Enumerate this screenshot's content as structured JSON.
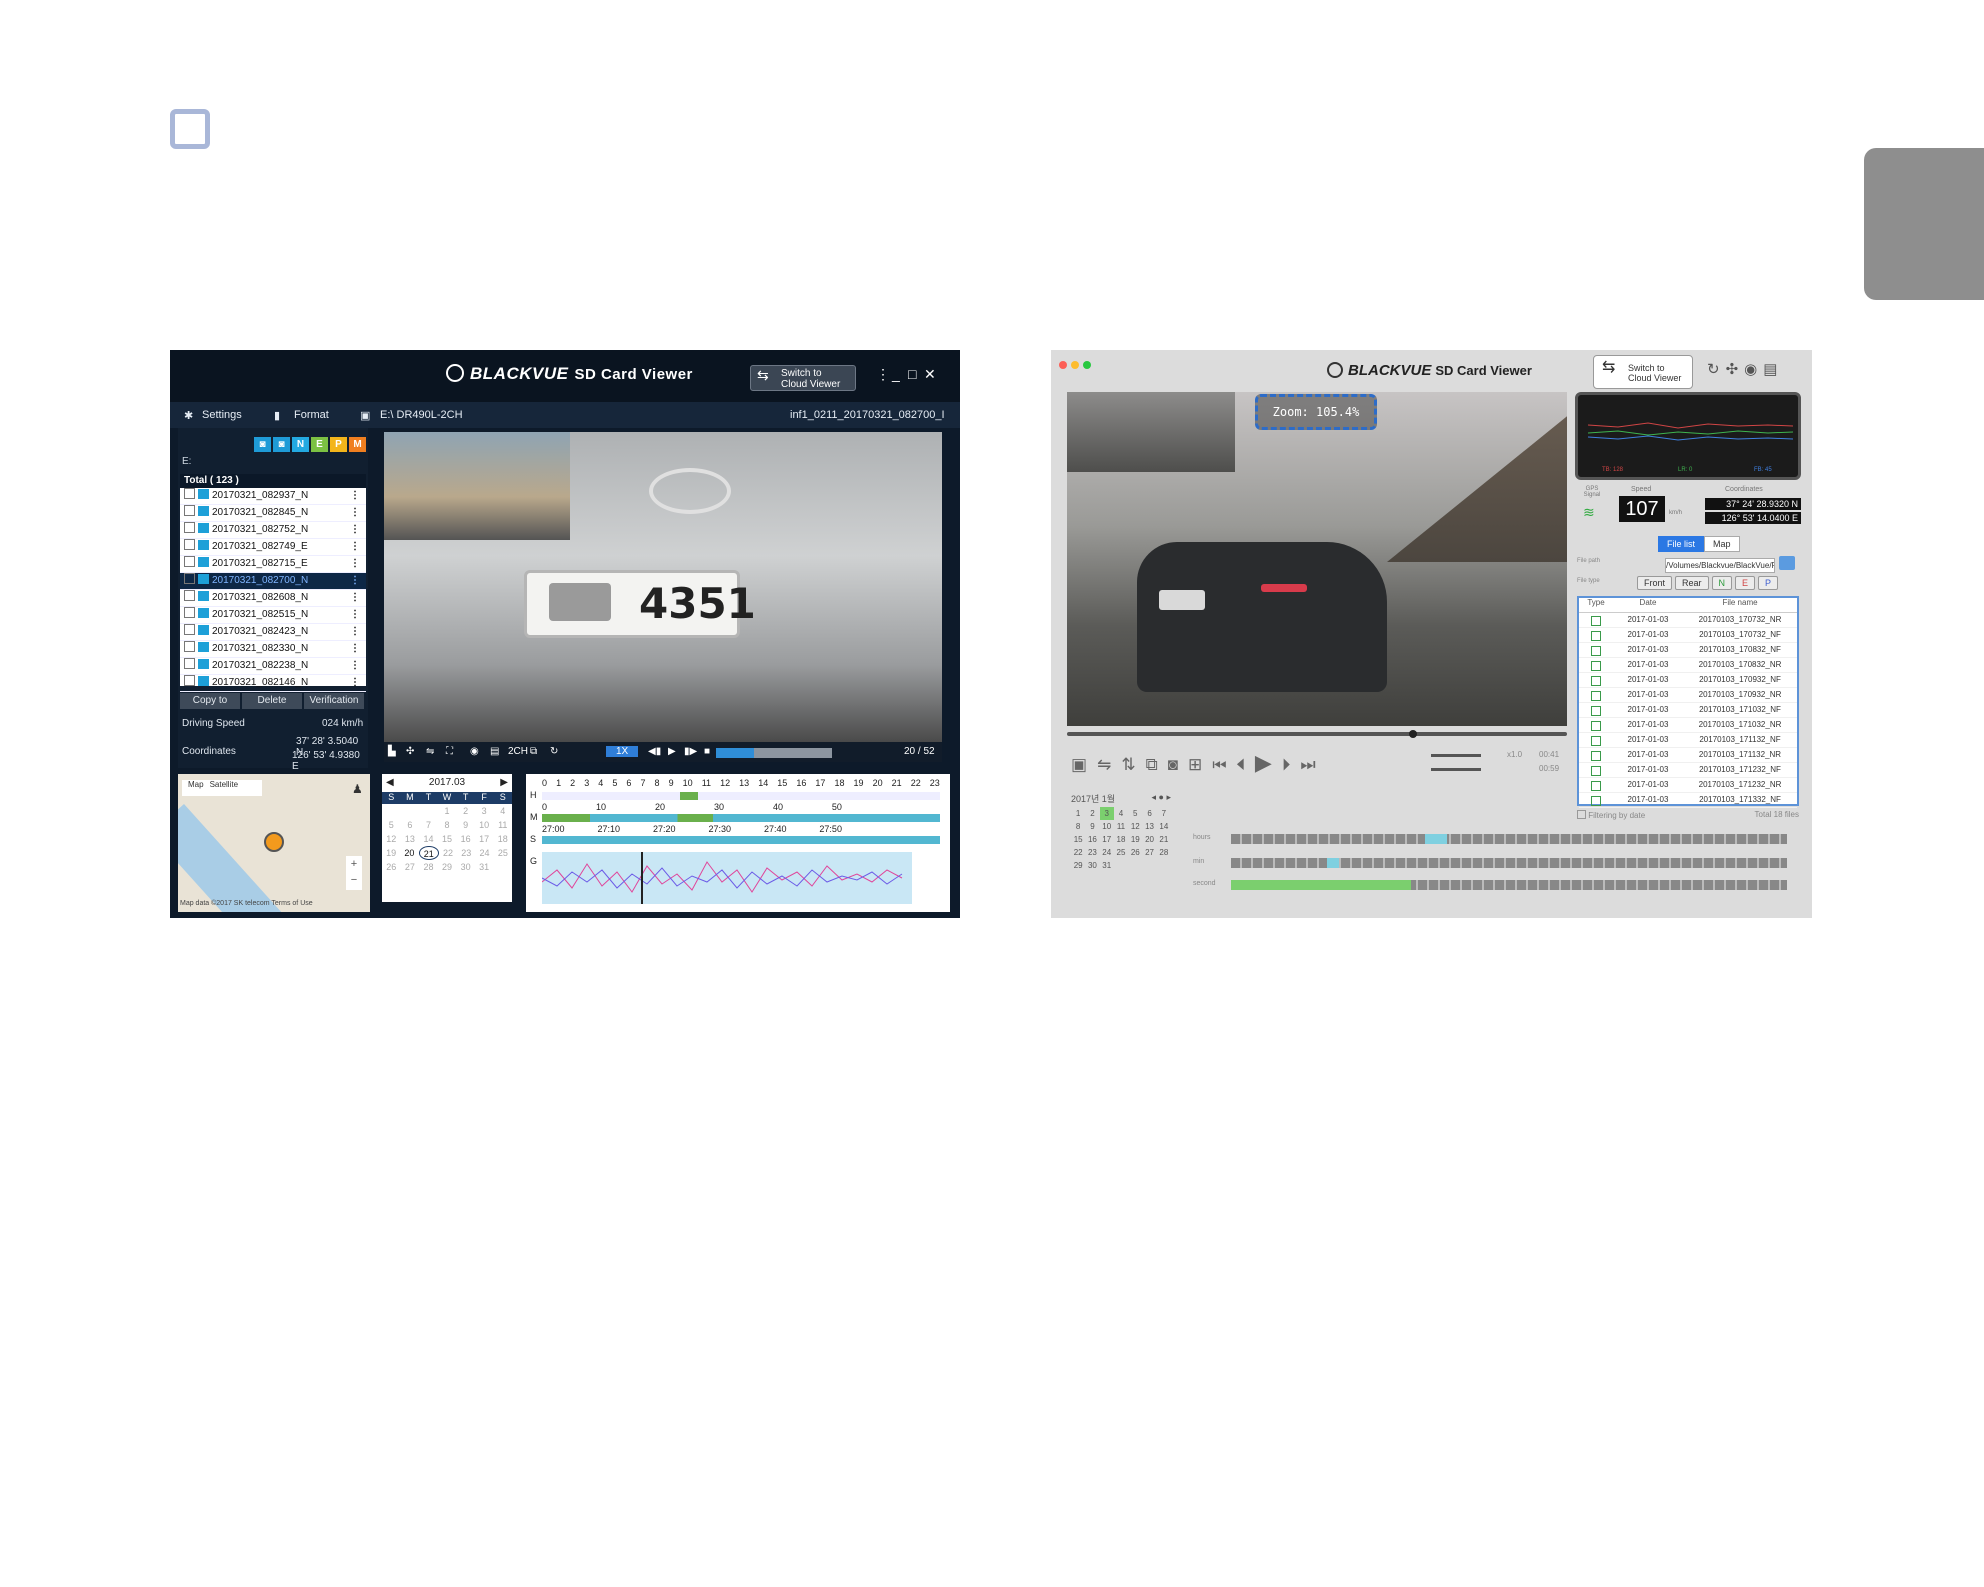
{
  "win": {
    "brand": "BLACKVUE",
    "brand_sub": "SD Card Viewer",
    "switch_label_1": "Switch to",
    "switch_label_2": "Cloud Viewer",
    "toolbar": {
      "settings": "Settings",
      "format": "Format",
      "drive": "E:\\ DR490L-2CH",
      "filename": "inf1_0211_20170321_082700_I"
    },
    "tags": [
      "N",
      "E",
      "P",
      "M"
    ],
    "drive_label": "E:",
    "list_header": "Total ( 123 )",
    "files": [
      "20170321_082937_N",
      "20170321_082845_N",
      "20170321_082752_N",
      "20170321_082749_E",
      "20170321_082715_E",
      "20170321_082700_N",
      "20170321_082608_N",
      "20170321_082515_N",
      "20170321_082423_N",
      "20170321_082330_N",
      "20170321_082238_N",
      "20170321_082146_N"
    ],
    "selected_index": 5,
    "actions": [
      "Copy to",
      "Delete",
      "Verification"
    ],
    "driving_speed_label": "Driving Speed",
    "driving_speed_value": "024 km/h",
    "coordinates_label": "Coordinates",
    "coord_lat": "37' 28' 3.5040 N",
    "coord_lon": "126' 53' 4.9380 E",
    "plate_number": "4351",
    "controls": {
      "channel": "2CH",
      "speed": "1X",
      "position": "20 / 52",
      "progress": 0.33
    },
    "map": {
      "tab_map": "Map",
      "tab_satellite": "Satellite",
      "footer": "Map data ©2017 SK telecom   Terms of Use"
    },
    "calendar": {
      "month": "2017.03",
      "weekdays": [
        "S",
        "M",
        "T",
        "W",
        "T",
        "F",
        "S"
      ],
      "weeks": [
        [
          "",
          "",
          "",
          "1",
          "2",
          "3",
          "4"
        ],
        [
          "5",
          "6",
          "7",
          "8",
          "9",
          "10",
          "11"
        ],
        [
          "12",
          "13",
          "14",
          "15",
          "16",
          "17",
          "18"
        ],
        [
          "19",
          "20",
          "21",
          "22",
          "23",
          "24",
          "25"
        ],
        [
          "26",
          "27",
          "28",
          "29",
          "30",
          "31",
          ""
        ]
      ]
    },
    "timeline": {
      "hours": [
        "0",
        "1",
        "2",
        "3",
        "4",
        "5",
        "6",
        "7",
        "8",
        "9",
        "10",
        "11",
        "12",
        "13",
        "14",
        "15",
        "16",
        "17",
        "18",
        "19",
        "20",
        "21",
        "22",
        "23"
      ],
      "minutes": [
        "0",
        "10",
        "20",
        "30",
        "40",
        "50"
      ],
      "seconds": [
        "27:00",
        "27:10",
        "27:20",
        "27:30",
        "27:40",
        "27:50"
      ],
      "row_h": "H",
      "row_m": "M",
      "row_s": "S",
      "row_g": "G"
    }
  },
  "mac": {
    "brand": "BLACKVUE",
    "brand_sub": "SD Card Viewer",
    "switch_label_1": "Switch to",
    "switch_label_2": "Cloud Viewer",
    "zoom_label": "Zoom: 105.4%",
    "graph_legend": [
      "TB: 128",
      "LR: 0",
      "FB: 45"
    ],
    "gps_label": "GPS Signal",
    "speed_label": "Speed",
    "speed_value": "107",
    "speed_unit": "km/h",
    "coord_label": "Coordinates",
    "coord_lat": "37° 24' 28.9320 N",
    "coord_lon": "126° 53' 14.0400 E",
    "tab_filelist": "File list",
    "tab_map": "Map",
    "file_path_label": "File path",
    "file_path": "/Volumes/Blackvue/BlackVue/Record",
    "file_type_label": "File type",
    "file_types": [
      "Front",
      "Rear",
      "N",
      "E",
      "P"
    ],
    "table_headers": [
      "Type",
      "Date",
      "File name"
    ],
    "files": [
      {
        "date": "2017-01-03",
        "name": "20170103_170732_NR"
      },
      {
        "date": "2017-01-03",
        "name": "20170103_170732_NF"
      },
      {
        "date": "2017-01-03",
        "name": "20170103_170832_NF"
      },
      {
        "date": "2017-01-03",
        "name": "20170103_170832_NR"
      },
      {
        "date": "2017-01-03",
        "name": "20170103_170932_NF"
      },
      {
        "date": "2017-01-03",
        "name": "20170103_170932_NR"
      },
      {
        "date": "2017-01-03",
        "name": "20170103_171032_NF"
      },
      {
        "date": "2017-01-03",
        "name": "20170103_171032_NR"
      },
      {
        "date": "2017-01-03",
        "name": "20170103_171132_NF"
      },
      {
        "date": "2017-01-03",
        "name": "20170103_171132_NR"
      },
      {
        "date": "2017-01-03",
        "name": "20170103_171232_NF"
      },
      {
        "date": "2017-01-03",
        "name": "20170103_171232_NR"
      },
      {
        "date": "2017-01-03",
        "name": "20170103_171332_NF"
      }
    ],
    "filter_label": "Filtering by date",
    "total_label": "Total 18 files",
    "playback_speed": "x1.0",
    "time_current": "00:41",
    "time_total": "00:59",
    "calendar": {
      "month": "2017년 1월",
      "weeks": [
        [
          "1",
          "2",
          "3",
          "4",
          "5",
          "6",
          "7"
        ],
        [
          "8",
          "9",
          "10",
          "11",
          "12",
          "13",
          "14"
        ],
        [
          "15",
          "16",
          "17",
          "18",
          "19",
          "20",
          "21"
        ],
        [
          "22",
          "23",
          "24",
          "25",
          "26",
          "27",
          "28"
        ],
        [
          "29",
          "30",
          "31",
          "",
          "",
          "",
          ""
        ]
      ]
    },
    "timeline_labels": [
      "hours",
      "min",
      "second"
    ]
  }
}
